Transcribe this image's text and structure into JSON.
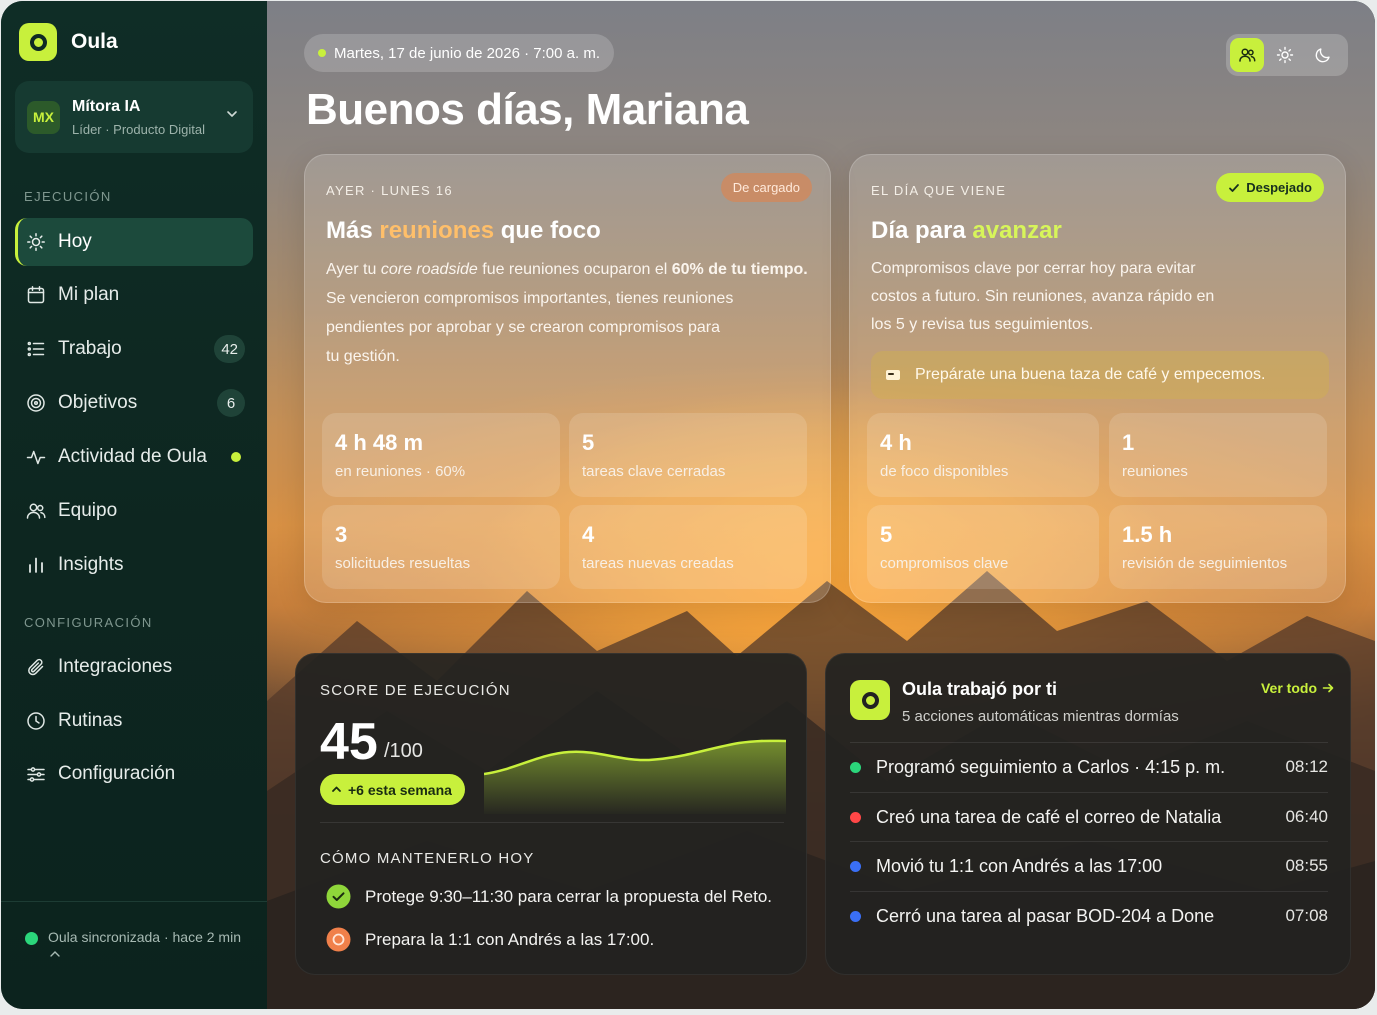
{
  "brand": {
    "name": "Oula"
  },
  "org": {
    "badge": "MX",
    "name": "Mítora IA",
    "role": "Líder · Producto Digital"
  },
  "sidebar": {
    "section_exec": "EJECUCIÓN",
    "section_config": "CONFIGURACIÓN",
    "items": [
      {
        "label": "Hoy",
        "icon": "sun-icon",
        "active": true
      },
      {
        "label": "Mi plan",
        "icon": "calendar-icon"
      },
      {
        "label": "Trabajo",
        "icon": "list-icon",
        "count": "42"
      },
      {
        "label": "Objetivos",
        "icon": "target-icon",
        "count": "6"
      },
      {
        "label": "Actividad de Oula",
        "icon": "activity-icon",
        "dot": true
      },
      {
        "label": "Equipo",
        "icon": "users-icon"
      },
      {
        "label": "Insights",
        "icon": "bar-chart-icon"
      }
    ],
    "config_items": [
      {
        "label": "Integraciones",
        "icon": "paperclip-icon"
      },
      {
        "label": "Rutinas",
        "icon": "clock-icon"
      },
      {
        "label": "Configuración",
        "icon": "sliders-icon"
      }
    ],
    "sync": "Oula sincronizada · hace 2 min"
  },
  "header": {
    "date": "Martes, 17 de junio de 2026 · 7:00 a. m.",
    "greeting": "Buenos días, Mariana"
  },
  "yesterday": {
    "eyebrow": "AYER · LUNES 16",
    "chip": "De cargado",
    "title_pre": "Más ",
    "title_hl": "reuniones",
    "title_post": " que foco",
    "body": {
      "p1": "Ayer tu ",
      "p2": "core roadside",
      "p3": " fue reuniones ocuparon el ",
      "p4": "60% de tu tiempo.",
      "l2": "Se vencieron compromisos importantes, tienes reuniones",
      "l3": "pendientes por aprobar y se crearon compromisos para",
      "l4": "tu gestión."
    },
    "stats": [
      {
        "value": "4 h 48 m",
        "label": "en reuniones · 60%"
      },
      {
        "value": "5",
        "label": "tareas clave cerradas"
      },
      {
        "value": "3",
        "label": "solicitudes resueltas"
      },
      {
        "value": "4",
        "label": "tareas nuevas creadas"
      }
    ]
  },
  "today": {
    "eyebrow": "EL DÍA QUE VIENE",
    "chip": "Despejado",
    "title_pre": "Día para ",
    "title_hl": "avanzar",
    "body": {
      "l1": "Compromisos clave por cerrar hoy para evitar",
      "l2": "costos a futuro. Sin reuniones, avanza rápido en",
      "l3": "los 5 y revisa tus seguimientos."
    },
    "tip": "Prepárate una buena taza de café y empecemos.",
    "stats": [
      {
        "value": "4 h",
        "label": "de foco disponibles"
      },
      {
        "value": "1",
        "label": "reuniones"
      },
      {
        "value": "5",
        "label": "compromisos clave"
      },
      {
        "value": "1.5 h",
        "label": "revisión de seguimientos"
      }
    ]
  },
  "score": {
    "label": "SCORE DE EJECUCIÓN",
    "value": "45",
    "max": "/100",
    "delta": "+6 esta semana",
    "keep_label": "CÓMO MANTENERLO HOY",
    "tasks": [
      {
        "text": "Protege 9:30–11:30 para cerrar la propuesta del Reto.",
        "state": "done",
        "color": "#8fd63a"
      },
      {
        "text": "Prepara la 1:1 con Andrés a las 17:00.",
        "state": "pending",
        "color": "#f0804a"
      }
    ]
  },
  "activity": {
    "title": "Oula trabajó por ti",
    "subtitle": "5 acciones automáticas mientras dormías",
    "link": "Ver todo",
    "items": [
      {
        "text": "Programó seguimiento a Carlos · 4:15 p. m.",
        "time": "08:12",
        "color": "#2bd67b"
      },
      {
        "text": "Creó una tarea de café el correo de Natalia",
        "time": "06:40",
        "color": "#ff4747"
      },
      {
        "text": "Movió tu 1:1 con Andrés a las 17:00",
        "time": "08:55",
        "color": "#3a6ff5"
      },
      {
        "text": "Cerró una tarea al pasar BOD-204 a Done",
        "time": "07:08",
        "color": "#3a6ff5"
      }
    ]
  },
  "colors": {
    "accent": "#c8f03c",
    "sidebar": "#0f2a24",
    "dark_card": "#222220"
  }
}
